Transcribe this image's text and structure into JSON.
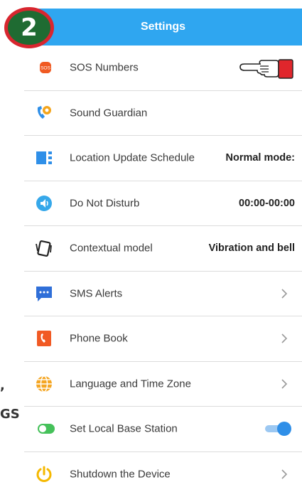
{
  "step_badge": "2",
  "header": {
    "title": "Settings"
  },
  "rows": [
    {
      "icon": "sos-icon",
      "icon_text": "SOS",
      "label": "SOS Numbers"
    },
    {
      "icon": "sound-guardian-icon",
      "label": "Sound Guardian"
    },
    {
      "icon": "location-schedule-icon",
      "label": "Location Update Schedule",
      "value": "Normal mode:"
    },
    {
      "icon": "do-not-disturb-icon",
      "label": "Do Not Disturb",
      "value": "00:00-00:00"
    },
    {
      "icon": "contextual-model-icon",
      "label": "Contextual model",
      "value": "Vibration and bell"
    },
    {
      "icon": "sms-alerts-icon",
      "label": "SMS Alerts"
    },
    {
      "icon": "phone-book-icon",
      "label": "Phone Book"
    },
    {
      "icon": "globe-icon",
      "label": "Language and Time Zone"
    },
    {
      "icon": "base-station-icon",
      "label": "Set Local Base Station",
      "toggle": "on"
    },
    {
      "icon": "power-icon",
      "label": "Shutdown the Device"
    }
  ],
  "side_texts": [
    ",",
    "GS"
  ],
  "colors": {
    "header": "#2fa6f0",
    "toggle": "#2f8fe8",
    "badge_green": "#1f6b32",
    "badge_red": "#d8262f"
  }
}
